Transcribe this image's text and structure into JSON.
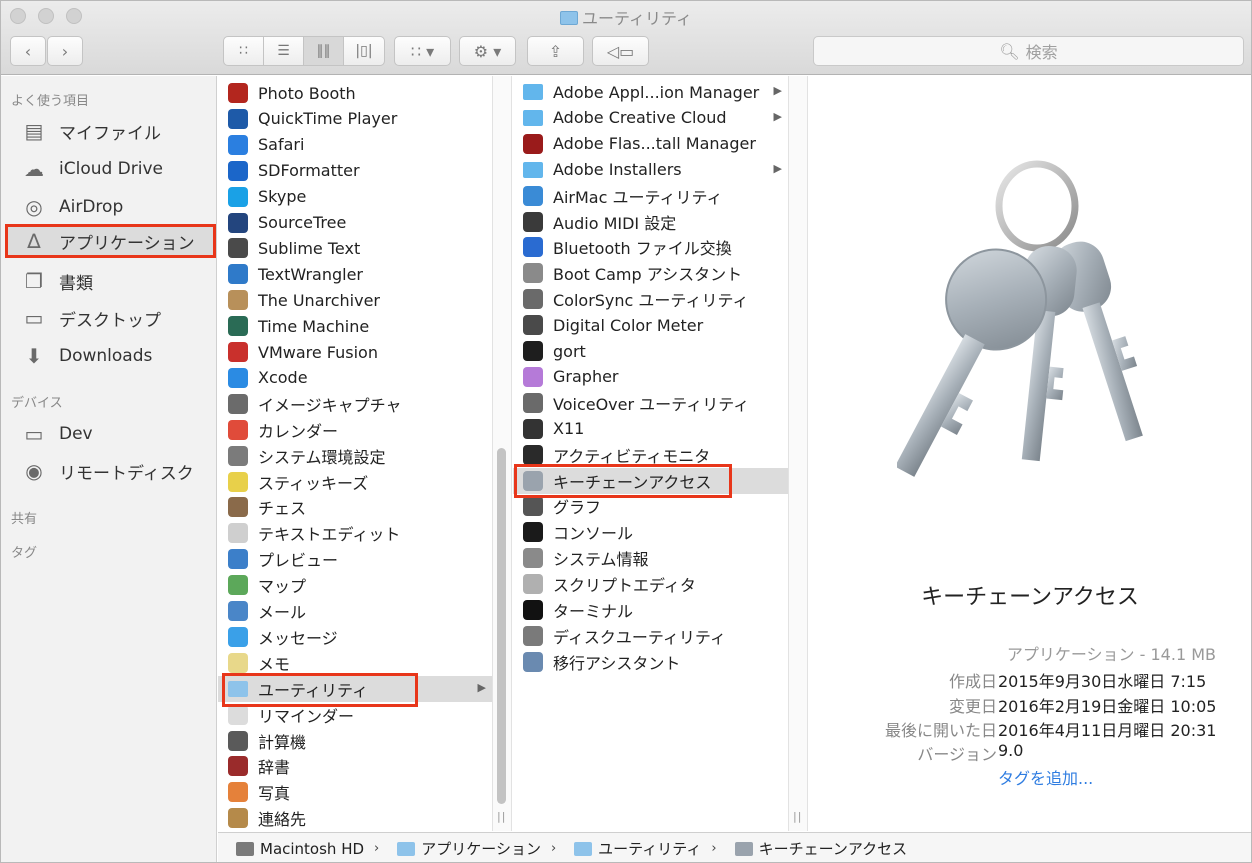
{
  "window": {
    "title": "ユーティリティ"
  },
  "toolbar": {
    "search_placeholder": "検索"
  },
  "sidebar": {
    "favorites_header": "よく使う項目",
    "favorites": [
      {
        "label": "マイファイル",
        "icon": "all-files-icon"
      },
      {
        "label": "iCloud Drive",
        "icon": "cloud-icon"
      },
      {
        "label": "AirDrop",
        "icon": "airdrop-icon"
      },
      {
        "label": "アプリケーション",
        "icon": "applications-icon",
        "selected": true
      },
      {
        "label": "書類",
        "icon": "documents-icon"
      },
      {
        "label": "デスクトップ",
        "icon": "desktop-icon"
      },
      {
        "label": "Downloads",
        "icon": "downloads-icon"
      }
    ],
    "devices_header": "デバイス",
    "devices": [
      {
        "label": "Dev",
        "icon": "laptop-icon"
      },
      {
        "label": "リモートディスク",
        "icon": "disc-icon"
      }
    ],
    "shared_header": "共有",
    "tags_header": "タグ"
  },
  "column1": [
    {
      "label": "Photo Booth",
      "color": "#b3261e"
    },
    {
      "label": "QuickTime Player",
      "color": "#1e5aa8"
    },
    {
      "label": "Safari",
      "color": "#2b7fe0"
    },
    {
      "label": "SDFormatter",
      "color": "#1b66c9"
    },
    {
      "label": "Skype",
      "color": "#1aa1e6"
    },
    {
      "label": "SourceTree",
      "color": "#23457e"
    },
    {
      "label": "Sublime Text",
      "color": "#4a4a4a"
    },
    {
      "label": "TextWrangler",
      "color": "#2f7ac9"
    },
    {
      "label": "The Unarchiver",
      "color": "#b8905a"
    },
    {
      "label": "Time Machine",
      "color": "#2a6b55"
    },
    {
      "label": "VMware Fusion",
      "color": "#c9302c"
    },
    {
      "label": "Xcode",
      "color": "#2b8be3"
    },
    {
      "label": "イメージキャプチャ",
      "color": "#6b6b6b"
    },
    {
      "label": "カレンダー",
      "color": "#e04b3a"
    },
    {
      "label": "システム環境設定",
      "color": "#7b7b7b"
    },
    {
      "label": "スティッキーズ",
      "color": "#e8d04a"
    },
    {
      "label": "チェス",
      "color": "#8a6a4a"
    },
    {
      "label": "テキストエディット",
      "color": "#cfcfcf"
    },
    {
      "label": "プレビュー",
      "color": "#3c7fc9"
    },
    {
      "label": "マップ",
      "color": "#5ca85a"
    },
    {
      "label": "メール",
      "color": "#4a86c8"
    },
    {
      "label": "メッセージ",
      "color": "#3aa0e8"
    },
    {
      "label": "メモ",
      "color": "#e8d88a"
    },
    {
      "label": "ユーティリティ",
      "color": "#8ec3ea",
      "selected": true,
      "folder": true
    },
    {
      "label": "リマインダー",
      "color": "#dcdcdc"
    },
    {
      "label": "計算機",
      "color": "#5a5a5a"
    },
    {
      "label": "辞書",
      "color": "#9a2b2b"
    },
    {
      "label": "写真",
      "color": "#e5813a"
    },
    {
      "label": "連絡先",
      "color": "#b58a4a"
    }
  ],
  "column2": [
    {
      "label": "Adobe Appl...ion Manager",
      "color": "#62b6ec",
      "folder": true
    },
    {
      "label": "Adobe Creative Cloud",
      "color": "#62b6ec",
      "folder": true
    },
    {
      "label": "Adobe Flas...tall Manager",
      "color": "#9a1b1b"
    },
    {
      "label": "Adobe Installers",
      "color": "#62b6ec",
      "folder": true
    },
    {
      "label": "AirMac ユーティリティ",
      "color": "#3a8bd6"
    },
    {
      "label": "Audio MIDI 設定",
      "color": "#3a3a3a"
    },
    {
      "label": "Bluetooth ファイル交換",
      "color": "#2a6bd1"
    },
    {
      "label": "Boot Camp アシスタント",
      "color": "#8a8a8a"
    },
    {
      "label": "ColorSync ユーティリティ",
      "color": "#6a6a6a"
    },
    {
      "label": "Digital Color Meter",
      "color": "#4a4a4a"
    },
    {
      "label": "gort",
      "color": "#1e1e1e"
    },
    {
      "label": "Grapher",
      "color": "#b57ad8"
    },
    {
      "label": "VoiceOver ユーティリティ",
      "color": "#6a6a6a"
    },
    {
      "label": "X11",
      "color": "#333333"
    },
    {
      "label": "アクティビティモニタ",
      "color": "#2a2a2a"
    },
    {
      "label": "キーチェーンアクセス",
      "color": "#9aa3ad",
      "selected": true
    },
    {
      "label": "グラフ",
      "color": "#555555"
    },
    {
      "label": "コンソール",
      "color": "#1a1a1a"
    },
    {
      "label": "システム情報",
      "color": "#8a8a8a"
    },
    {
      "label": "スクリプトエディタ",
      "color": "#b0b0b0"
    },
    {
      "label": "ターミナル",
      "color": "#111111"
    },
    {
      "label": "ディスクユーティリティ",
      "color": "#7a7a7a"
    },
    {
      "label": "移行アシスタント",
      "color": "#6a8ab0"
    }
  ],
  "preview": {
    "name": "キーチェーンアクセス",
    "kind": "アプリケーション - 14.1 MB",
    "created_label": "作成日",
    "created_value": "2015年9月30日水曜日 7:15",
    "modified_label": "変更日",
    "modified_value": "2016年2月19日金曜日 10:05",
    "opened_label": "最後に開いた日",
    "opened_value": "2016年4月11日月曜日 20:31",
    "version_label": "バージョン",
    "version_value": "9.0",
    "add_tags": "タグを追加..."
  },
  "pathbar": [
    {
      "label": "Macintosh HD",
      "color": "#7a7a7a"
    },
    {
      "label": "アプリケーション",
      "color": "#8ec3ea"
    },
    {
      "label": "ユーティリティ",
      "color": "#8ec3ea"
    },
    {
      "label": "キーチェーンアクセス",
      "color": "#9aa3ad"
    }
  ]
}
